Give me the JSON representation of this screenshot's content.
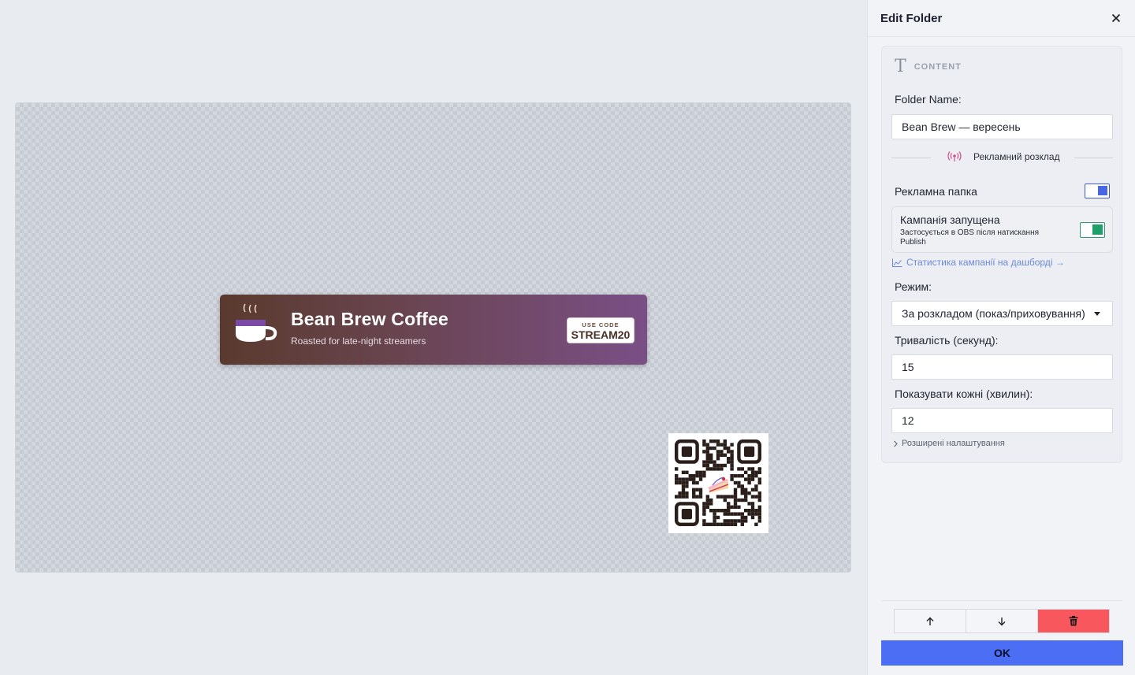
{
  "canvas": {
    "banner": {
      "title": "Bean Brew Coffee",
      "subtitle": "Roasted for late-night streamers",
      "promo_small": "USE CODE",
      "promo_code": "STREAM20",
      "gradient_colors": [
        "#5a3a2e",
        "#7a4f86"
      ]
    },
    "qr_icon": "qr-code-with-cake"
  },
  "panel": {
    "title": "Edit Folder",
    "section_label": "CONTENT",
    "folder_name_label": "Folder Name:",
    "folder_name_value": "Bean Brew — вересень",
    "ad_schedule_label": "Рекламний розклад",
    "ad_folder_label": "Рекламна папка",
    "campaign_title": "Кампанія запущена",
    "campaign_subtitle": "Застосується в OBS після натискання Publish",
    "stats_link": "Статистика кампанії на дашборді →",
    "mode_label": "Режим:",
    "mode_value": "За розкладом (показ/приховування)",
    "duration_label": "Тривалість (секунд):",
    "duration_value": "15",
    "interval_label": "Показувати кожні (хвилин):",
    "interval_value": "12",
    "advanced_label": "Розширені налаштування",
    "ok_label": "OK",
    "colors": {
      "accent": "#4c6ef5",
      "toggle_blue": "#4866e6",
      "toggle_green": "#1fa06a",
      "danger": "#f7575d",
      "link": "#6b8ad6"
    }
  }
}
